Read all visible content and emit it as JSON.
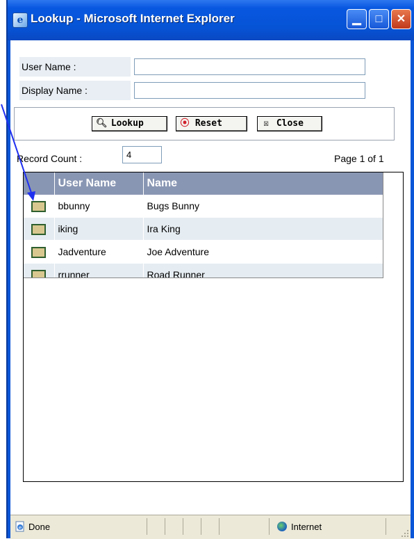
{
  "window": {
    "title": "Lookup - Microsoft Internet Explorer",
    "title_icon": "ie-page-icon",
    "buttons": {
      "minimize": "_",
      "maximize": "□",
      "close": "X"
    }
  },
  "form": {
    "user_name_label": "User Name :",
    "user_name_value": "",
    "display_name_label": "Display Name :",
    "display_name_value": ""
  },
  "buttons": {
    "lookup_label": "Lookup",
    "reset_label": "Reset",
    "close_label": "Close"
  },
  "record_count": {
    "label": "Record Count :",
    "value": "4"
  },
  "page_info": "Page 1 of 1",
  "grid": {
    "columns": [
      "User Name",
      "Name"
    ],
    "rows": [
      {
        "user_name": "bbunny",
        "name": "Bugs Bunny"
      },
      {
        "user_name": "iking",
        "name": "Ira King"
      },
      {
        "user_name": "Jadventure",
        "name": "Joe Adventure"
      },
      {
        "user_name": "rrunner",
        "name": "Road Runner"
      }
    ]
  },
  "status": {
    "text": "Done",
    "zone": "Internet"
  },
  "colors": {
    "title_bar": "#0857e0",
    "header_bg": "#8996b3",
    "alt_row": "#e6edf2",
    "annotation_arrow": "#1f2ff0"
  }
}
